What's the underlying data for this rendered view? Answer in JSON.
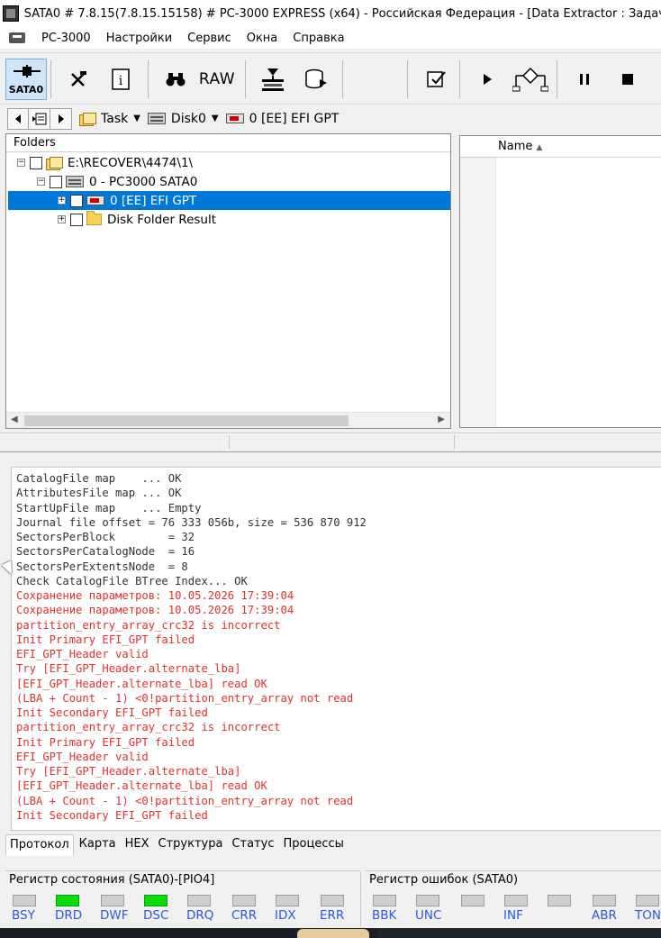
{
  "window": {
    "title": "SATA0 # 7.8.15(7.8.15.15158) # PC-3000 EXPRESS (x64) - Российская Федерация - [Data Extractor : Задача"
  },
  "menu": [
    "PC-3000",
    "Настройки",
    "Сервис",
    "Окна",
    "Справка"
  ],
  "toolbar": {
    "sata_label": "SATA0",
    "raw_label": "RAW"
  },
  "navbar": {
    "task_label": "Task",
    "disk_label": "Disk0",
    "partition_label": "0 [EE] EFI GPT"
  },
  "folders": {
    "header": "Folders",
    "tree": [
      {
        "label": "E:\\RECOVER\\4474\\1\\",
        "expander": "−",
        "icon": "task-folder-icon",
        "selected": false
      },
      {
        "label": "0 - PC3000 SATA0",
        "expander": "−",
        "icon": "drive-icon",
        "selected": false
      },
      {
        "label": "0 [EE] EFI GPT",
        "expander": "+",
        "icon": "partition-icon",
        "selected": true
      },
      {
        "label": "Disk Folder Result",
        "expander": "+",
        "icon": "folder-icon",
        "selected": false
      }
    ]
  },
  "files": {
    "name_header": "Name",
    "sort_indicator": "▲"
  },
  "log": [
    {
      "text": "CatalogFile map    ... OK",
      "color": "black"
    },
    {
      "text": "AttributesFile map ... OK",
      "color": "black"
    },
    {
      "text": "StartUpFile map    ... Empty",
      "color": "black"
    },
    {
      "text": "Journal file offset = 76 333 056b, size = 536 870 912",
      "color": "black"
    },
    {
      "text": "SectorsPerBlock        = 32",
      "color": "black"
    },
    {
      "text": "SectorsPerCatalogNode  = 16",
      "color": "black"
    },
    {
      "text": "SectorsPerExtentsNode  = 8",
      "color": "black"
    },
    {
      "text": "Check CatalogFile BTree Index... OK",
      "color": "black"
    },
    {
      "text": "Сохранение параметров: 10.05.2026 17:39:04",
      "color": "red"
    },
    {
      "text": "Сохранение параметров: 10.05.2026 17:39:04",
      "color": "red"
    },
    {
      "text": "partition_entry_array_crc32 is incorrect",
      "color": "red"
    },
    {
      "text": "Init Primary EFI_GPT failed",
      "color": "red"
    },
    {
      "text": "EFI_GPT_Header valid",
      "color": "red"
    },
    {
      "text": "Try [EFI_GPT_Header.alternate_lba]",
      "color": "red"
    },
    {
      "text": "[EFI_GPT_Header.alternate_lba] read OK",
      "color": "red"
    },
    {
      "text": "(LBA + Count - 1) <0!partition_entry_array not read",
      "color": "red"
    },
    {
      "text": "Init Secondary EFI_GPT failed",
      "color": "red"
    },
    {
      "text": "partition_entry_array_crc32 is incorrect",
      "color": "red"
    },
    {
      "text": "Init Primary EFI_GPT failed",
      "color": "red"
    },
    {
      "text": "EFI_GPT_Header valid",
      "color": "red"
    },
    {
      "text": "Try [EFI_GPT_Header.alternate_lba]",
      "color": "red"
    },
    {
      "text": "[EFI_GPT_Header.alternate_lba] read OK",
      "color": "red"
    },
    {
      "text": "(LBA + Count - 1) <0!partition_entry_array not read",
      "color": "red"
    },
    {
      "text": "Init Secondary EFI_GPT failed",
      "color": "red"
    }
  ],
  "tabs": [
    "Протокол",
    "Карта",
    "HEX",
    "Структура",
    "Статус",
    "Процессы"
  ],
  "status_register": {
    "title": "Регистр состояния (SATA0)-[PIO4]",
    "leds": [
      {
        "label": "BSY",
        "on": false
      },
      {
        "label": "DRD",
        "on": true
      },
      {
        "label": "DWF",
        "on": false
      },
      {
        "label": "DSC",
        "on": true
      },
      {
        "label": "DRQ",
        "on": false
      },
      {
        "label": "CRR",
        "on": false
      },
      {
        "label": "IDX",
        "on": false
      },
      {
        "label": "ERR",
        "on": false
      }
    ]
  },
  "error_register": {
    "title": "Регистр ошибок  (SATA0)",
    "leds": [
      {
        "label": "BBK",
        "on": false
      },
      {
        "label": "UNC",
        "on": false
      },
      {
        "label": "",
        "on": false
      },
      {
        "label": "INF",
        "on": false
      },
      {
        "label": "",
        "on": false
      },
      {
        "label": "ABR",
        "on": false
      },
      {
        "label": "TON",
        "on": false
      }
    ]
  },
  "colors": {
    "selection": "#0078d7",
    "log_error": "#e03030",
    "led_on": "#0bdc0b",
    "led_label": "#2a5ad7"
  }
}
